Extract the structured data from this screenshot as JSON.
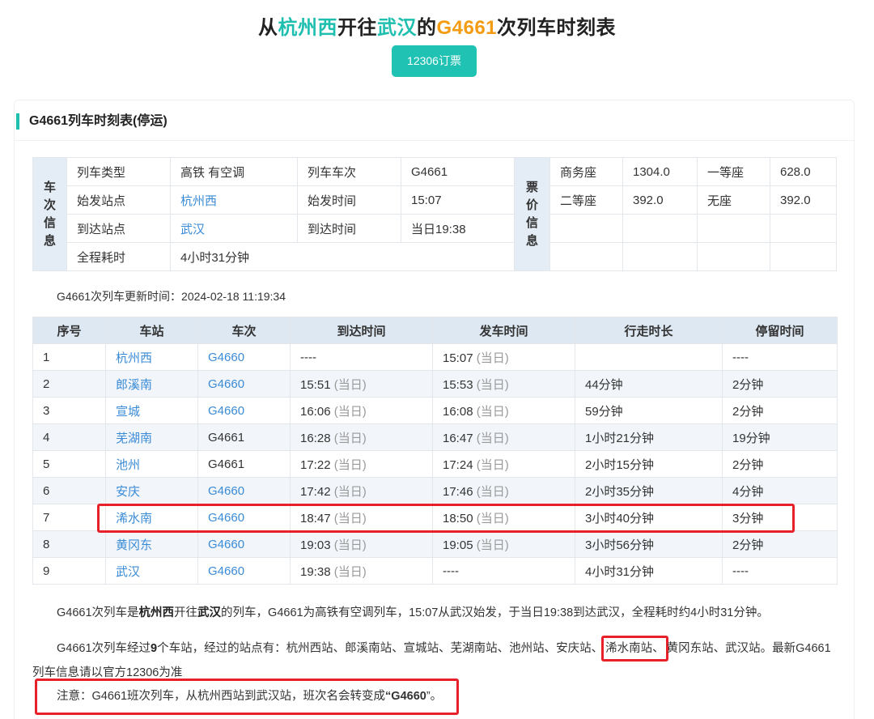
{
  "title": {
    "prefix": "从",
    "from": "杭州西",
    "mid1": "开往",
    "to": "武汉",
    "mid2": "的",
    "train": "G4661",
    "suffix": "次列车时刻表"
  },
  "book_button": "12306订票",
  "section_title": "G4661列车时刻表(停运)",
  "info": {
    "train_info_label": "车次信息",
    "price_info_label": "票价信息",
    "train_type_label": "列车类型",
    "train_type": "高铁 有空调",
    "train_no_label": "列车车次",
    "train_no": "G4661",
    "start_station_label": "始发站点",
    "start_station": "杭州西",
    "start_time_label": "始发时间",
    "start_time": "15:07",
    "end_station_label": "到达站点",
    "end_station": "武汉",
    "end_time_label": "到达时间",
    "end_time": "当日19:38",
    "duration_label": "全程耗时",
    "duration": "4小时31分钟",
    "prices": [
      {
        "seat": "商务座",
        "price": "1304.0"
      },
      {
        "seat": "一等座",
        "price": "628.0"
      },
      {
        "seat": "二等座",
        "price": "392.0"
      },
      {
        "seat": "无座",
        "price": "392.0"
      }
    ]
  },
  "update_text": "G4661次列车更新时间：2024-02-18 11:19:34",
  "stops": {
    "headers": [
      "序号",
      "车站",
      "车次",
      "到达时间",
      "发车时间",
      "行走时长",
      "停留时间"
    ],
    "same_day": "(当日)",
    "rows": [
      {
        "no": "1",
        "station": "杭州西",
        "train": "G4660",
        "train_link": true,
        "arrive": "----",
        "arrive_same": false,
        "depart": "15:07",
        "depart_same": true,
        "travel": "",
        "stay": "----"
      },
      {
        "no": "2",
        "station": "郎溪南",
        "train": "G4660",
        "train_link": true,
        "arrive": "15:51",
        "arrive_same": true,
        "depart": "15:53",
        "depart_same": true,
        "travel": "44分钟",
        "stay": "2分钟"
      },
      {
        "no": "3",
        "station": "宣城",
        "train": "G4660",
        "train_link": true,
        "arrive": "16:06",
        "arrive_same": true,
        "depart": "16:08",
        "depart_same": true,
        "travel": "59分钟",
        "stay": "2分钟"
      },
      {
        "no": "4",
        "station": "芜湖南",
        "train": "G4661",
        "train_link": false,
        "arrive": "16:28",
        "arrive_same": true,
        "depart": "16:47",
        "depart_same": true,
        "travel": "1小时21分钟",
        "stay": "19分钟"
      },
      {
        "no": "5",
        "station": "池州",
        "train": "G4661",
        "train_link": false,
        "arrive": "17:22",
        "arrive_same": true,
        "depart": "17:24",
        "depart_same": true,
        "travel": "2小时15分钟",
        "stay": "2分钟"
      },
      {
        "no": "6",
        "station": "安庆",
        "train": "G4660",
        "train_link": true,
        "arrive": "17:42",
        "arrive_same": true,
        "depart": "17:46",
        "depart_same": true,
        "travel": "2小时35分钟",
        "stay": "4分钟"
      },
      {
        "no": "7",
        "station": "浠水南",
        "train": "G4660",
        "train_link": true,
        "arrive": "18:47",
        "arrive_same": true,
        "depart": "18:50",
        "depart_same": true,
        "travel": "3小时40分钟",
        "stay": "3分钟"
      },
      {
        "no": "8",
        "station": "黄冈东",
        "train": "G4660",
        "train_link": true,
        "arrive": "19:03",
        "arrive_same": true,
        "depart": "19:05",
        "depart_same": true,
        "travel": "3小时56分钟",
        "stay": "2分钟"
      },
      {
        "no": "9",
        "station": "武汉",
        "train": "G4660",
        "train_link": true,
        "arrive": "19:38",
        "arrive_same": true,
        "depart": "----",
        "depart_same": false,
        "travel": "4小时31分钟",
        "stay": "----"
      }
    ]
  },
  "paragraph1": {
    "a": "G4661次列车是",
    "from": "杭州西",
    "b": "开往",
    "to": "武汉",
    "c": "的列车，G4661为高铁有空调列车，15:07从武汉始发，于当日19:38到达武汉，全程耗时约4小时31分钟。"
  },
  "paragraph2": {
    "a": "G4661次列车经过",
    "count": "9",
    "b": "个车站，经过的站点有：杭州西站、郎溪南站、宣城站、芜湖南站、池州站、安庆站、",
    "highlight": "浠水南站、",
    "c": "黄冈东站、武汉站。最新G4661列车信息请以官方12306为准"
  },
  "note": {
    "a": "注意：G4661班次列车，从杭州西站到武汉站，班次名会转变成",
    "open_quote": "“",
    "train": "G4660",
    "close": "”。"
  }
}
